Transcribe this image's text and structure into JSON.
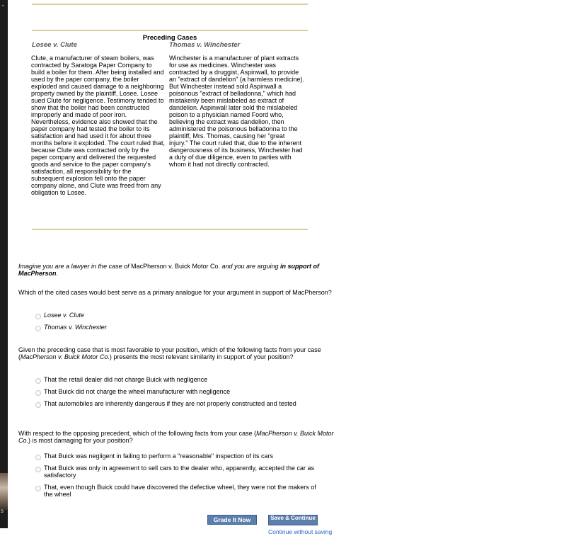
{
  "header": {
    "title": "Preceding Cases"
  },
  "cases": [
    {
      "name": "Losee v. Clute",
      "text": "Clute, a manufacturer of steam boilers, was contracted by Saratoga Paper Company to build a boiler for them. After being installed and used by the paper company, the boiler exploded and caused damage to a neighboring property owned by the plaintiff, Losee. Losee sued Clute for negligence. Testimony tended to show that the boiler had been constructed improperly and made of poor iron. Nevertheless, evidence also showed that the paper company had tested the boiler to its satisfaction and had used it for about three months before it exploded. The court ruled that, because Clute was contracted only by the paper company and delivered the requested goods and service to the paper company's satisfaction, all responsibility for the subsequent explosion fell onto the paper company alone, and Clute was freed from any obligation to Losee."
    },
    {
      "name": "Thomas v. Winchester",
      "text": "Winchester is a manufacturer of plant extracts for use as medicines. Winchester was contracted by a druggist, Aspinwall, to provide an \"extract of dandelion\" (a harmless medicine). But Winchester instead sold Aspinwall a poisonous \"extract of belladonna,\" which had mistakenly been mislabeled as extract of dandelion. Aspinwall later sold the mislabeled poison to a physician named Foord who, believing the extract was dandelion, then administered the poisonous belladonna to the plaintiff, Mrs. Thomas, causing her \"great injury.\" The court ruled that, due to the inherent dangerousness of its business, Winchester had a duty of due diligence, even to parties with whom it had not directly contracted."
    }
  ],
  "prompt": {
    "part1": "Imagine you are a lawyer in the case of ",
    "case": "MacPherson v. Buick Motor Co.",
    "part2": " and you are arguing ",
    "emph": "in support of MacPherson",
    "part3": "."
  },
  "questions": [
    {
      "stem": "Which of the cited cases would best serve as a primary analogue for your argument in support of MacPherson?",
      "options": [
        "Losee v. Clute",
        "Thomas v. Winchester"
      ]
    },
    {
      "stem_a": "Given the preceding case that is most favorable to your position, which of the following facts from your case (",
      "stem_case": "MacPherson v. Buick Motor Co.",
      "stem_b": ") presents the most relevant similarity in support of your position?",
      "options": [
        "That the retail dealer did not charge Buick with negligence",
        "That Buick did not charge the wheel manufacturer with negligence",
        "That automobiles are inherently dangerous if they are not properly constructed and tested"
      ]
    },
    {
      "stem_a": "With respect to the opposing precedent, which of the following facts from your case (",
      "stem_case": "MacPherson v. Buick Motor Co.",
      "stem_b": ") is most damaging for your position?",
      "options": [
        "That Buick was negligent in failing to perform a \"reasonable\" inspection of its cars",
        "That Buick was only in agreement to sell cars to the dealer who, apparently, accepted the car as satisfactory",
        "That, even though Buick could have discovered the defective wheel, they were not the makers of the wheel"
      ]
    }
  ],
  "actions": {
    "grade": "Grade It Now",
    "save": "Save & Continue",
    "continue_link": "Continue without saving"
  },
  "sidebar": {
    "tick": "⌄",
    "letter": "s"
  }
}
